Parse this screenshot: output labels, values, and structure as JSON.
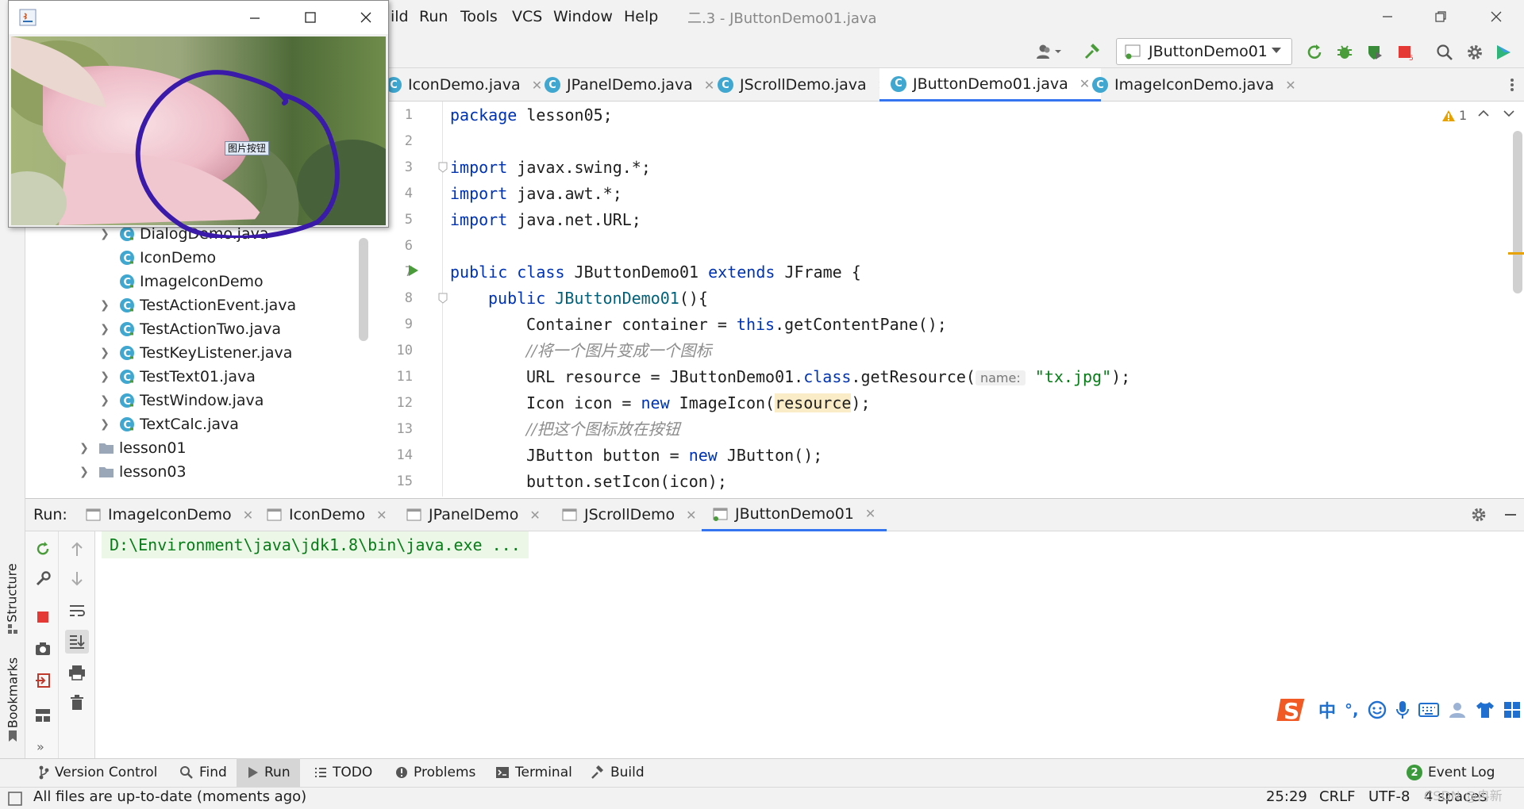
{
  "menu": {
    "items": [
      "ild",
      "Run",
      "Tools",
      "VCS",
      "Window",
      "Help"
    ],
    "title": "二.3 - JButtonDemo01.java"
  },
  "toolbar": {
    "run_config": "JButtonDemo01"
  },
  "editor_tabs": [
    {
      "label": "IconDemo.java"
    },
    {
      "label": "JPanelDemo.java"
    },
    {
      "label": "JScrollDemo.java"
    },
    {
      "label": "JButtonDemo01.java",
      "active": true
    },
    {
      "label": "ImageIconDemo.java"
    }
  ],
  "warnings": {
    "count": "1"
  },
  "project_tree": [
    {
      "label": "DialogDemo.java",
      "chev": true
    },
    {
      "label": "IconDemo",
      "chev": false
    },
    {
      "label": "ImageIconDemo",
      "chev": false
    },
    {
      "label": "TestActionEvent.java",
      "chev": true
    },
    {
      "label": "TestActionTwo.java",
      "chev": true
    },
    {
      "label": "TestKeyListener.java",
      "chev": true
    },
    {
      "label": "TestText01.java",
      "chev": true
    },
    {
      "label": "TestWindow.java",
      "chev": true
    },
    {
      "label": "TextCalc.java",
      "chev": true
    },
    {
      "label": "lesson01",
      "folder": true
    },
    {
      "label": "lesson03",
      "folder": true
    }
  ],
  "line_numbers": [
    "1",
    "2",
    "3",
    "4",
    "5",
    "6",
    "7",
    "8",
    "9",
    "10",
    "11",
    "12",
    "13",
    "14",
    "15"
  ],
  "code": {
    "l1_kw": "package",
    "l1_rest": " lesson05;",
    "l3_kw": "import",
    "l3_rest": " javax.swing.*;",
    "l4_kw": "import",
    "l4_rest": " java.awt.*;",
    "l5_kw": "import",
    "l5_rest": " java.net.URL;",
    "l7_kw1": "public",
    "l7_kw2": "class",
    "l7_name": " JButtonDemo01 ",
    "l7_kw3": "extends",
    "l7_rest": " JFrame {",
    "l8_kw": "public",
    "l8_fn": "JButtonDemo01",
    "l8_rest": "(){",
    "l9_a": "Container container = ",
    "l9_kw": "this",
    "l9_b": ".getContentPane();",
    "l10_cm": "//将一个图片变成一个图标",
    "l11_a": "URL resource = JButtonDemo01.",
    "l11_kw": "class",
    "l11_b": ".getResource(",
    "l11_hint": "name:",
    "l11_str": "\"tx.jpg\"",
    "l11_c": ");",
    "l12_a": "Icon icon = ",
    "l12_kw": "new",
    "l12_b": " ImageIcon(",
    "l12_hl": "resource",
    "l12_c": ");",
    "l13_cm": "//把这个图标放在按钮",
    "l14_a": "JButton button = ",
    "l14_kw": "new",
    "l14_b": " JButton();",
    "l15_a": "button.setIcon(icon);"
  },
  "run_panel": {
    "label": "Run:",
    "tabs": [
      "ImageIconDemo",
      "IconDemo",
      "JPanelDemo",
      "JScrollDemo",
      "JButtonDemo01"
    ],
    "console_line": "D:\\Environment\\java\\jdk1.8\\bin\\java.exe ..."
  },
  "side_labels": {
    "structure": "Structure",
    "bookmarks": "Bookmarks"
  },
  "tool_windows": [
    "Version Control",
    "Find",
    "Run",
    "TODO",
    "Problems",
    "Terminal",
    "Build"
  ],
  "event_log": {
    "count": "2",
    "label": "Event Log"
  },
  "status": {
    "message": "All files are up-to-date (moments ago)",
    "position": "25:29",
    "line_sep": "CRLF",
    "encoding": "UTF-8",
    "indent": "4 spaces"
  },
  "swing_window": {
    "button_label": "图片按钮"
  },
  "ime": {
    "lang": "中",
    "punct": "°,"
  },
  "watermark": "CSDN @冉新"
}
